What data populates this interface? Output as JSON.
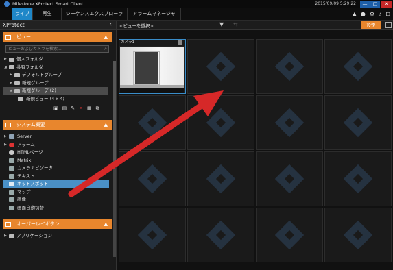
{
  "window": {
    "title": "Milestone XProtect Smart Client",
    "timestamp": "2015/09/09 5:29:22",
    "minimize": "—",
    "maximize": "□",
    "close": "✕"
  },
  "tabs": [
    {
      "label": "ライブ"
    },
    {
      "label": "再生"
    },
    {
      "label": "シーケンスエクスプローラ"
    },
    {
      "label": "アラームマネージャ"
    }
  ],
  "tab_icons": [
    "▲",
    "●",
    "⚙",
    "?",
    "⊡"
  ],
  "sidebar": {
    "title": "XProtect",
    "collapse": "‹",
    "views_section": {
      "label": "ビュー",
      "chevron": "▲"
    },
    "search_placeholder": "ビューおよびカメラを検索...",
    "search_icon": "⌕",
    "tree": [
      {
        "arrow": "▶",
        "label": "個人フォルダ"
      },
      {
        "arrow": "◢",
        "label": "共有フォルダ"
      },
      {
        "arrow": "▶",
        "label": "デフォルトグループ"
      },
      {
        "arrow": "▶",
        "label": "新規グループ"
      },
      {
        "arrow": "◢",
        "label": "新規グループ (2)"
      },
      {
        "arrow": "",
        "label": "新規ビュー (4 x 4)"
      }
    ],
    "toolbar": [
      "▣",
      "▤",
      "✎",
      "✕",
      "▦",
      "⧉"
    ],
    "system_section": {
      "label": "システム概要",
      "chevron": "▲"
    },
    "system_items": [
      {
        "arrow": "▶",
        "label": "Server"
      },
      {
        "arrow": "▶",
        "label": "アラーム"
      },
      {
        "arrow": "",
        "label": "HTMLページ"
      },
      {
        "arrow": "",
        "label": "Matrix"
      },
      {
        "arrow": "",
        "label": "カメラナビゲータ"
      },
      {
        "arrow": "",
        "label": "テキスト"
      },
      {
        "arrow": "",
        "label": "ホットスポット"
      },
      {
        "arrow": "",
        "label": "マップ"
      },
      {
        "arrow": "",
        "label": "画像"
      },
      {
        "arrow": "",
        "label": "画面自動切替"
      }
    ],
    "overlay_section": {
      "label": "オーバーレイボタン",
      "chevron": "▲"
    },
    "overlay_items": [
      {
        "arrow": "▶",
        "label": "アプリケーション"
      }
    ]
  },
  "viewbar": {
    "selected_view": "<ビューを選択>",
    "dropdown_arrow": "▼",
    "dim_icon": "⇆",
    "setup_label": "設定"
  },
  "camera_tile": {
    "label": "カメラ1",
    "rec_icon": "■"
  },
  "colors": {
    "accent_blue": "#1f87c8",
    "section_orange": "#e8862d",
    "arrow_red": "#d62828"
  }
}
